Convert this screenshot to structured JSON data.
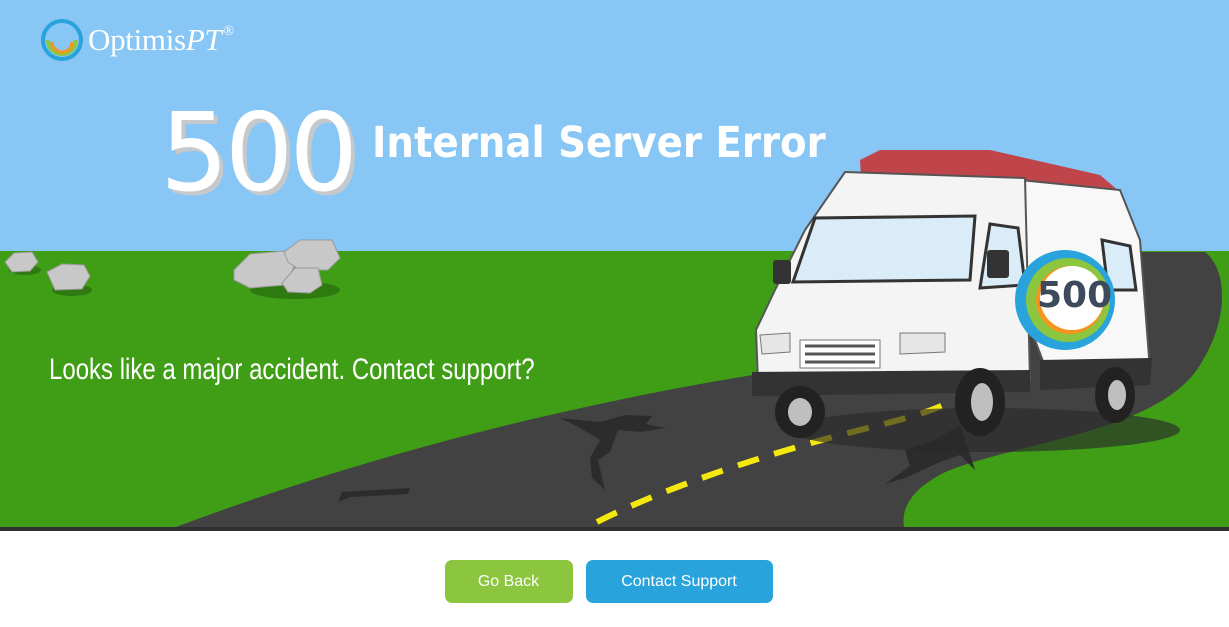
{
  "brand": {
    "name": "Optimis",
    "name_suffix": "PT",
    "registered_mark": "®"
  },
  "error": {
    "code": "500",
    "title": "Internal Server Error",
    "message": "Looks like a major accident. Contact support?",
    "van_badge": "500"
  },
  "actions": {
    "go_back_label": "Go Back",
    "contact_support_label": "Contact Support"
  },
  "colors": {
    "sky": "#87c6f5",
    "grass": "#3f9e16",
    "road": "#424242",
    "road_line": "#f5e80f",
    "van_roof": "#c0454a",
    "go_back_button": "#8cc63f",
    "contact_support_button": "#29a3dc"
  },
  "icons": {
    "logo": "optimispt-logo-icon"
  }
}
